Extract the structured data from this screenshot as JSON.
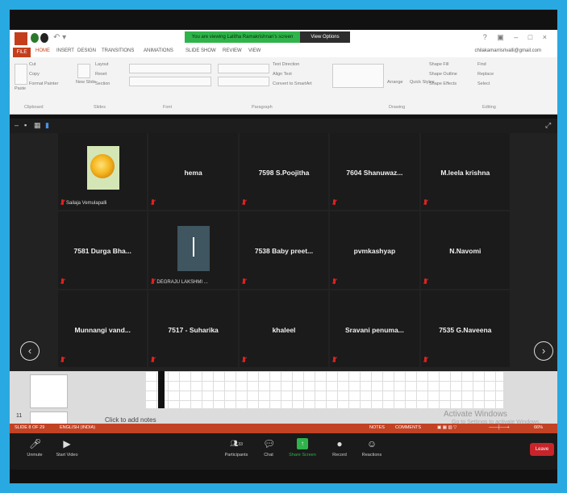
{
  "title_bar": {
    "share_banner": "You are viewing Lalitha Ramakrishnan's screen",
    "view_options": "View Options",
    "window_controls": "? ▣ – □ ×"
  },
  "tabs": [
    "FILE",
    "HOME",
    "INSERT",
    "DESIGN",
    "TRANSITIONS",
    "ANIMATIONS",
    "SLIDE SHOW",
    "REVIEW",
    "VIEW"
  ],
  "account": "chilakamarrisrivalli@gmail.com",
  "ribbon": {
    "groups": [
      "Clipboard",
      "Slides",
      "Font",
      "Paragraph",
      "Drawing",
      "Editing"
    ],
    "items": {
      "cut": "Cut",
      "copy": "Copy",
      "paste": "Paste",
      "format_painter": "Format Painter",
      "layout": "Layout",
      "reset": "Reset",
      "new_slide": "New Slide",
      "section": "Section",
      "text_direction": "Text Direction",
      "align_text": "Align Text",
      "convert_smartart": "Convert to SmartArt",
      "arrange": "Arrange",
      "quick_styles": "Quick Styles",
      "shape_fill": "Shape Fill",
      "shape_outline": "Shape Outline",
      "shape_effects": "Shape Effects",
      "find": "Find",
      "replace": "Replace",
      "select": "Select"
    }
  },
  "participants": [
    {
      "name": "Sailaja Vemulapalli",
      "type": "image-rose"
    },
    {
      "name": "hema"
    },
    {
      "name": "7598 S.Poojitha"
    },
    {
      "name": "7604 Shanuwaz..."
    },
    {
      "name": "M.leela krishna"
    },
    {
      "name": "7581 Durga Bha..."
    },
    {
      "name": "DEGRAJU LAKSHMI ...",
      "type": "avatar-gray"
    },
    {
      "name": "7538 Baby preet..."
    },
    {
      "name": "pvmkashyap"
    },
    {
      "name": "N.Navomi"
    },
    {
      "name": "Munnangi vand..."
    },
    {
      "name": "7517 - Suharika"
    },
    {
      "name": "khaleel"
    },
    {
      "name": "Sravani penuma..."
    },
    {
      "name": "7535 G.Naveena"
    }
  ],
  "slide_panel": {
    "slide_number": "11",
    "notes_placeholder": "Click to add notes",
    "activate_title": "Activate Windows",
    "activate_sub": "Go to Settings to activate Windows."
  },
  "status_bar": {
    "slide_info": "SLIDE 8 OF 29",
    "language": "ENGLISH (INDIA)",
    "notes": "NOTES",
    "comments": "COMMENTS",
    "zoom": "66%"
  },
  "toolbar": {
    "unmute": "Unmute",
    "start_video": "Start Video",
    "participants": "Participants",
    "participant_count": "33",
    "chat": "Chat",
    "share_screen": "Share Screen",
    "record": "Record",
    "reactions": "Reactions",
    "leave": "Leave"
  }
}
